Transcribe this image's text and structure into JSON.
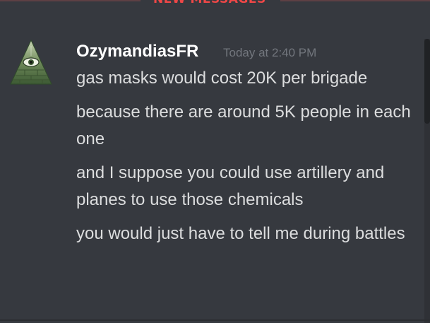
{
  "divider": {
    "label": "NEW MESSAGES"
  },
  "message": {
    "author": "OzymandiasFR",
    "timestamp": "Today at 2:40 PM",
    "avatar_icon": "illuminati-pyramid-icon",
    "lines": [
      "gas masks would cost 20K per brigade",
      "because there are around 5K people in each one",
      "and I suppose you could use artillery and planes to use those chemicals",
      "you would just have to tell me during battles"
    ]
  },
  "colors": {
    "background": "#36393f",
    "new_messages_red": "#f04747",
    "username": "#ffffff",
    "timestamp": "#72767d",
    "text": "#dcddde"
  }
}
